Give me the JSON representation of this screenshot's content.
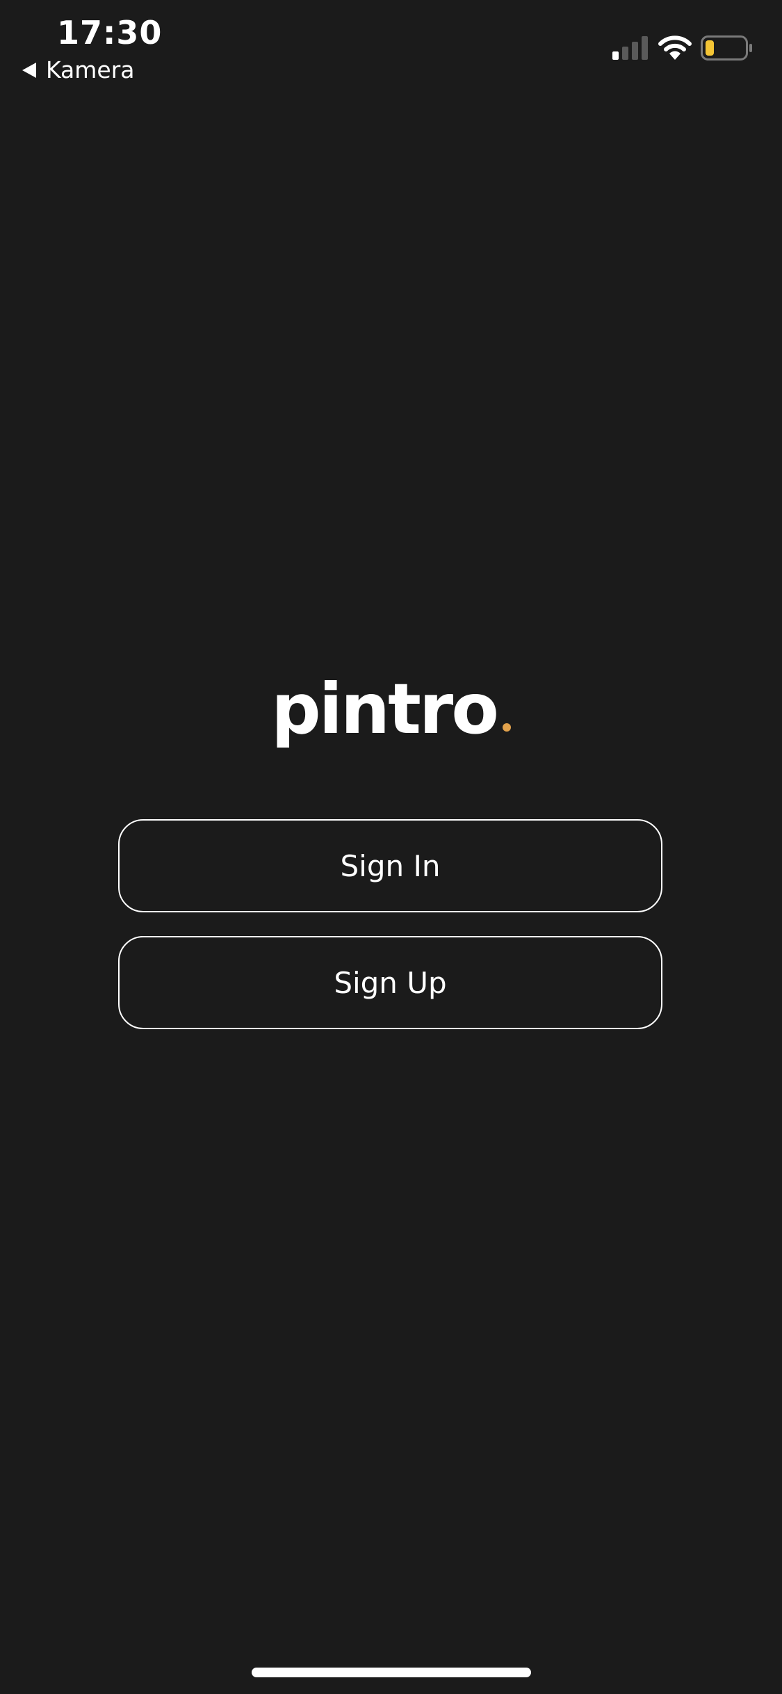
{
  "status_bar": {
    "time": "17:30",
    "back_app_label": "Kamera",
    "battery_color": "#f4c535",
    "icons": [
      "signal-icon",
      "wifi-icon",
      "battery-icon"
    ]
  },
  "logo": {
    "text": "pintro",
    "accent_color": "#e2a24c"
  },
  "auth": {
    "sign_in_label": "Sign In",
    "sign_up_label": "Sign Up"
  },
  "theme": {
    "background": "#1b1b1b",
    "foreground": "#ffffff"
  }
}
